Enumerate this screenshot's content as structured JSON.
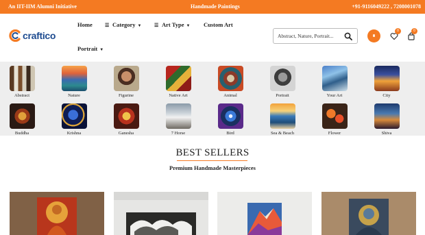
{
  "topbar": {
    "left_text": "An IIT-IIM Alumni Initiative",
    "center_text": "Handmade Paintings",
    "right_text": "+91-9116049222 , 7208001078"
  },
  "brand": {
    "name": "craftico"
  },
  "nav": {
    "home": "Home",
    "category": "Category",
    "art_type": "Art Type",
    "custom_art": "Custom Art",
    "portrait": "Portrait"
  },
  "search": {
    "placeholder": "Abstract, Nature, Portrait..."
  },
  "header_icons": {
    "wishlist_count": "0",
    "cart_count": "0"
  },
  "categories_row1": [
    "Abstract",
    "Nature",
    "Figurine",
    "Native Art",
    "Animal",
    "Portrait",
    "Your Art",
    "City"
  ],
  "categories_row2": [
    "Buddha",
    "Krishna",
    "Ganesha",
    "7 Horse",
    "Bird",
    "Sea & Beach",
    "Flower",
    "Shiva"
  ],
  "best_sellers": {
    "title": "BEST SELLERS",
    "subtitle": "Premium Handmade Masterpieces"
  },
  "colors": {
    "accent": "#f47a22",
    "brand_blue": "#1c4a8f",
    "category_band": "#eeeeee"
  }
}
